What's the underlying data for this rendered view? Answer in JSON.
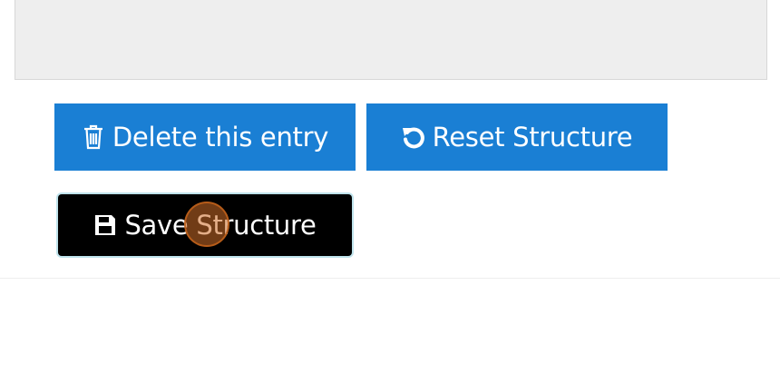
{
  "actions": {
    "delete_label": "Delete this entry",
    "reset_label": "Reset Structure",
    "save_label": "Save Structure",
    "delete_icon": "trash-icon",
    "reset_icon": "undo-icon",
    "save_icon": "floppy-disk-icon"
  },
  "colors": {
    "primary_button": "#1a7fd4",
    "save_button": "#000000",
    "panel_background": "#eeeeee",
    "click_indicator": "#ce6e28"
  }
}
